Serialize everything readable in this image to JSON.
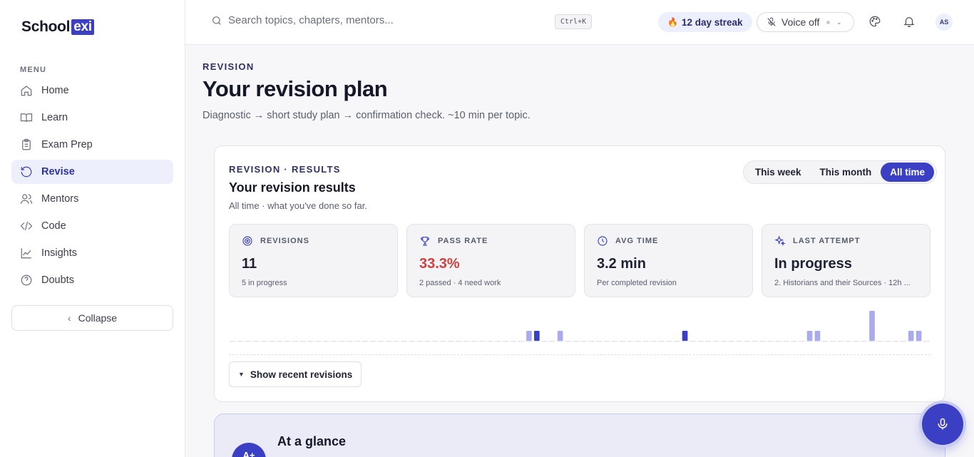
{
  "brand": {
    "name": "School",
    "badge": "exi"
  },
  "sidebar": {
    "menu_label": "MENU",
    "items": [
      {
        "label": "Home",
        "icon": "home-icon"
      },
      {
        "label": "Learn",
        "icon": "book-icon"
      },
      {
        "label": "Exam Prep",
        "icon": "clipboard-icon"
      },
      {
        "label": "Revise",
        "icon": "rotate-icon",
        "active": true
      },
      {
        "label": "Mentors",
        "icon": "users-icon"
      },
      {
        "label": "Code",
        "icon": "code-icon"
      },
      {
        "label": "Insights",
        "icon": "chart-icon"
      },
      {
        "label": "Doubts",
        "icon": "help-icon"
      }
    ],
    "collapse_label": "Collapse"
  },
  "topbar": {
    "search_placeholder": "Search topics, chapters, mentors...",
    "shortcut": "Ctrl+K",
    "streak": "12 day streak",
    "voice": "Voice off",
    "avatar": "AS"
  },
  "page": {
    "eyebrow": "REVISION",
    "title": "Your revision plan",
    "subtitle": "Diagnostic → short study plan → confirmation check. ~10 min per topic."
  },
  "results": {
    "eyebrow": "REVISION · RESULTS",
    "title": "Your revision results",
    "subtitle": "All time · what you've done so far.",
    "ranges": [
      "This week",
      "This month",
      "All time"
    ],
    "active_range": "All time",
    "stats": [
      {
        "label": "REVISIONS",
        "value": "11",
        "note": "5 in progress",
        "icon": "target-icon"
      },
      {
        "label": "PASS RATE",
        "value": "33.3%",
        "note": "2 passed · 4 need work",
        "icon": "trophy-icon"
      },
      {
        "label": "AVG TIME",
        "value": "3.2 min",
        "note": "Per completed revision",
        "icon": "clock-icon"
      },
      {
        "label": "LAST ATTEMPT",
        "value": "In progress",
        "note": "2. Historians and their Sources · 12h ...",
        "icon": "sparkle-icon"
      }
    ],
    "show_recent_label": "Show recent revisions"
  },
  "activity_chart": {
    "type": "bar",
    "day_count": 90,
    "colors": {
      "light": "#a9abec",
      "dark": "#3b3fc4",
      "baseline": "#e4e5ec"
    },
    "bars": [
      {
        "day": 38,
        "level": 1,
        "kind": "light"
      },
      {
        "day": 39,
        "level": 1,
        "kind": "dark"
      },
      {
        "day": 42,
        "level": 1,
        "kind": "light"
      },
      {
        "day": 58,
        "level": 1,
        "kind": "dark"
      },
      {
        "day": 74,
        "level": 1,
        "kind": "light"
      },
      {
        "day": 75,
        "level": 1,
        "kind": "light"
      },
      {
        "day": 82,
        "level": 3,
        "kind": "light"
      },
      {
        "day": 87,
        "level": 1,
        "kind": "light"
      },
      {
        "day": 88,
        "level": 1,
        "kind": "light"
      }
    ]
  },
  "glance": {
    "title": "At a glance",
    "badge": "A+"
  }
}
